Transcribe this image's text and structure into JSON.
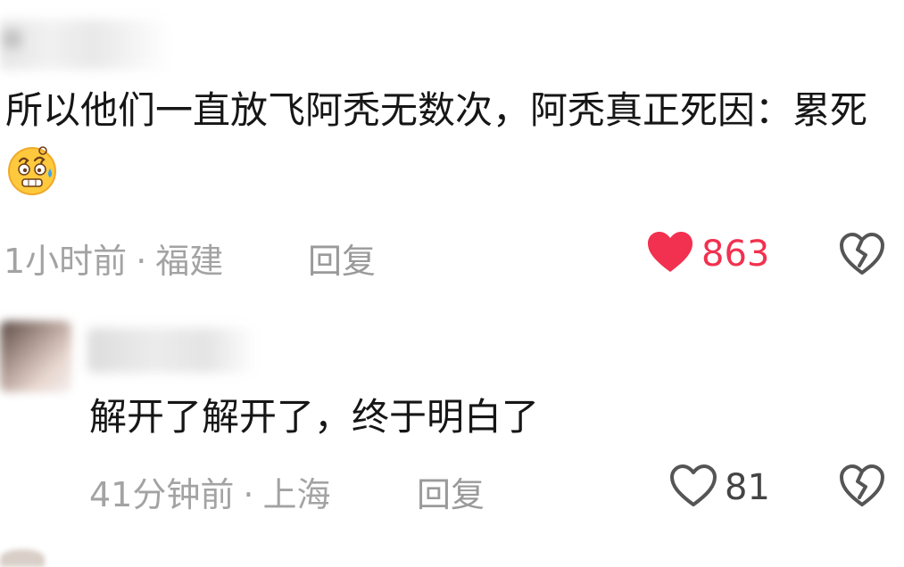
{
  "comments": [
    {
      "text_main": "所以他们一直放飞阿秃无数次，阿秃真正死因：累死",
      "emoji": "sweat-dizzy-face-emoji",
      "time": "1小时前",
      "location": "福建",
      "reply_label": "回复",
      "like_count": "863",
      "liked": true
    },
    {
      "text_main": "解开了解开了，终于明白了",
      "time": "41分钟前",
      "location": "上海",
      "reply_label": "回复",
      "like_count": "81",
      "liked": false
    }
  ],
  "separator": "·",
  "colors": {
    "like_active": "#f2304f",
    "meta_text": "#a3a3a3",
    "body_text": "#161616"
  }
}
